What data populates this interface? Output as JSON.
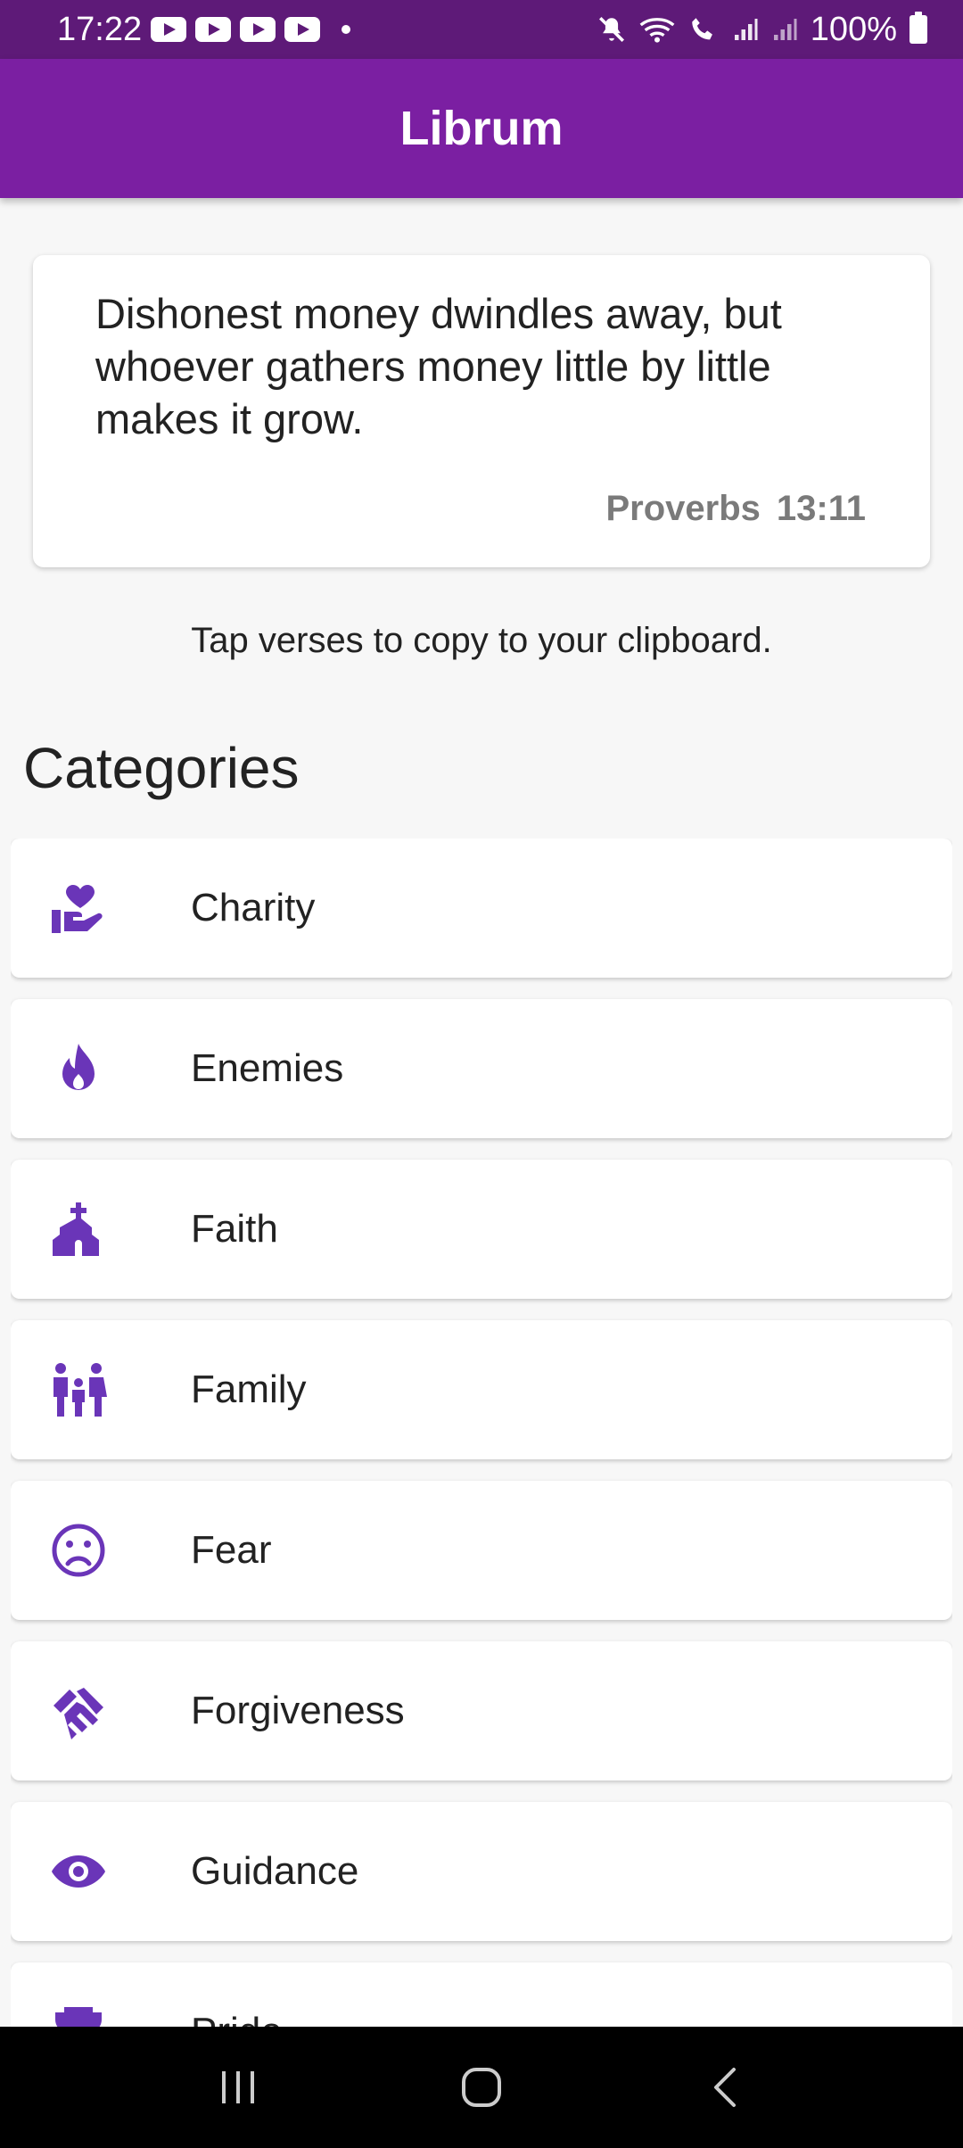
{
  "status": {
    "time": "17:22",
    "battery": "100%"
  },
  "app": {
    "title": "Librum"
  },
  "verse": {
    "text": "Dishonest money dwindles away, but whoever gathers money little by little makes it grow.",
    "book": "Proverbs",
    "reference": "13:11"
  },
  "hint": "Tap verses to copy to your clipboard.",
  "categories_title": "Categories",
  "categories": [
    {
      "label": "Charity",
      "icon": "heart-hand-icon"
    },
    {
      "label": "Enemies",
      "icon": "fire-icon"
    },
    {
      "label": "Faith",
      "icon": "church-icon"
    },
    {
      "label": "Family",
      "icon": "family-icon"
    },
    {
      "label": "Fear",
      "icon": "sad-face-icon"
    },
    {
      "label": "Forgiveness",
      "icon": "handshake-icon"
    },
    {
      "label": "Guidance",
      "icon": "eye-icon"
    },
    {
      "label": "Pride",
      "icon": "trophy-icon"
    }
  ],
  "colors": {
    "status_bar": "#5e1a78",
    "app_bar": "#7b1fa2",
    "icon": "#6a35b8"
  }
}
